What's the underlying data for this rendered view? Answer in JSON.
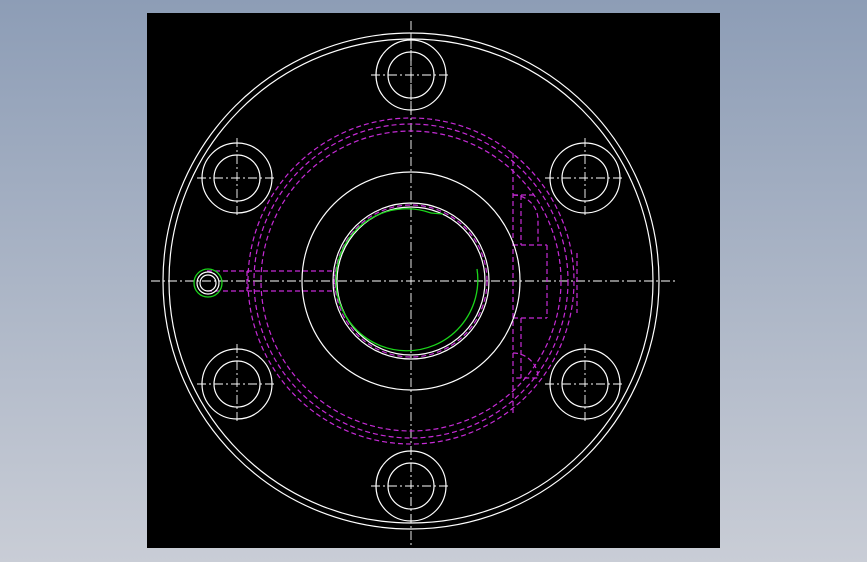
{
  "colors": {
    "bg_top": "#8d9db6",
    "bg_bottom": "#c9cdd6",
    "viewport_bg": "#000000",
    "outline": "#ffffff",
    "hidden": "#c62bd6",
    "center_line": "#ffffff",
    "thread": "#1bd51b"
  },
  "drawing": {
    "view": "top-view",
    "flange": "round-flange",
    "bolt_hole_count": 6,
    "bolt_holes": [
      "top",
      "upper-left",
      "upper-right",
      "lower-left",
      "lower-right",
      "bottom"
    ],
    "side_port": "left",
    "icons": {
      "bolt_hole": "bolt-hole-icon",
      "bore": "bore-icon",
      "thread": "thread-arc-icon"
    }
  }
}
